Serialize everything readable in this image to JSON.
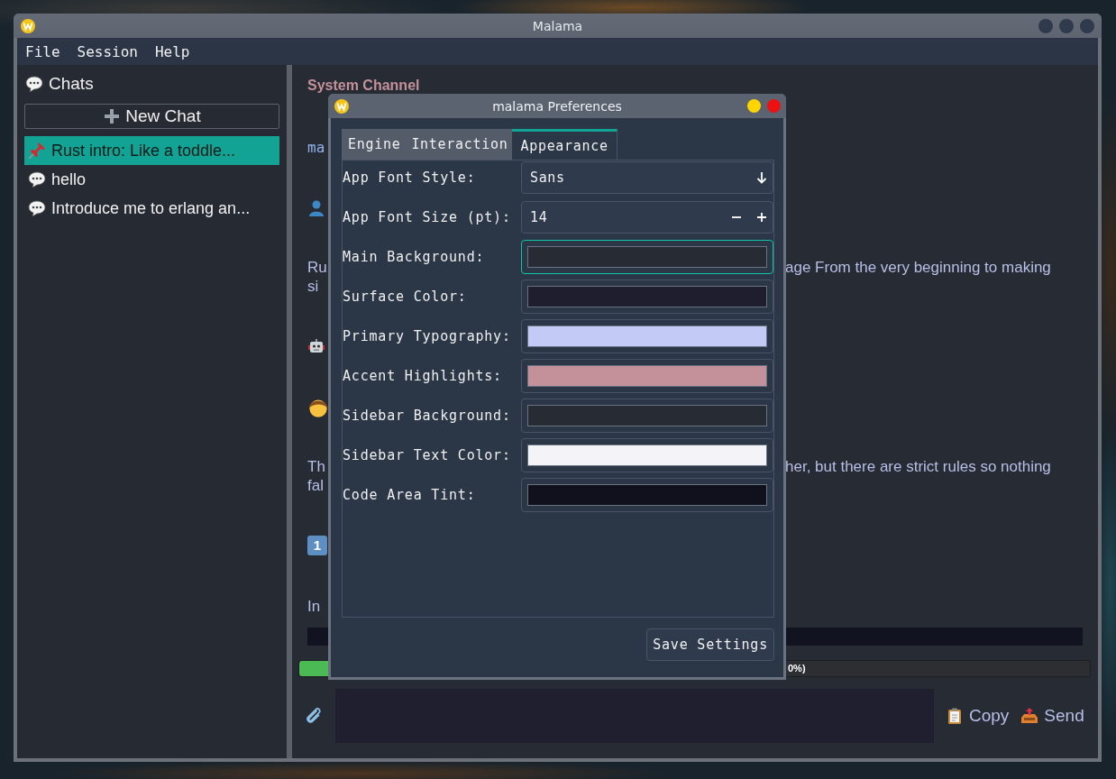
{
  "window": {
    "title": "Malama"
  },
  "menu": [
    "File",
    "Session",
    "Help"
  ],
  "sidebar": {
    "heading": "Chats",
    "new_chat": "New Chat",
    "items": [
      {
        "label": "Rust intro: Like a toddle...",
        "pinned": true,
        "selected": true
      },
      {
        "label": "hello",
        "pinned": false,
        "selected": false
      },
      {
        "label": "Introduce me to erlang an...",
        "pinned": false,
        "selected": false
      }
    ]
  },
  "chat": {
    "blocks": [
      {
        "kind": "heading",
        "text": "System Channel"
      },
      {
        "kind": "code",
        "text": "ma"
      },
      {
        "kind": "user"
      },
      {
        "kind": "paragraph",
        "lines": [
          {
            "left": "Ru",
            "right": "age From the very beginning to making"
          },
          {
            "left": "si"
          }
        ]
      },
      {
        "kind": "bot"
      },
      {
        "kind": "child"
      },
      {
        "kind": "paragraph",
        "lines": [
          {
            "left": "Th",
            "right": "her, but there are strict rules so nothing"
          },
          {
            "left": "fal"
          }
        ]
      },
      {
        "kind": "keycap",
        "text": "1"
      },
      {
        "kind": "paragraph",
        "lines": [
          {
            "left": "In"
          }
        ]
      },
      {
        "kind": "codebar"
      }
    ]
  },
  "progress": {
    "level": 0.04,
    "label": "0%)"
  },
  "composer": {
    "buttons": [
      {
        "kind": "copy",
        "label": "Copy"
      },
      {
        "kind": "send",
        "label": "Send"
      }
    ]
  },
  "dialog": {
    "title": "malama Preferences",
    "tabs": [
      {
        "label": "Engine",
        "selected": false
      },
      {
        "label": "Interaction",
        "selected": false
      },
      {
        "label": "Appearance",
        "selected": true
      }
    ],
    "fields": [
      {
        "kind": "dropdown",
        "label": "App Font Style:",
        "value": "Sans"
      },
      {
        "kind": "spin",
        "label": "App Font Size (pt):",
        "value": "14"
      },
      {
        "kind": "color",
        "label": "Main Background:",
        "color": "#272b34",
        "focused": true
      },
      {
        "kind": "color",
        "label": "Surface Color:",
        "color": "#1f1e2e",
        "focused": false
      },
      {
        "kind": "color",
        "label": "Primary Typography:",
        "color": "#c3caf5",
        "focused": false
      },
      {
        "kind": "color",
        "label": "Accent Highlights:",
        "color": "#c4919a",
        "focused": false
      },
      {
        "kind": "color",
        "label": "Sidebar Background:",
        "color": "#272b34",
        "focused": false
      },
      {
        "kind": "color",
        "label": "Sidebar Text Color:",
        "color": "#f4f4f8",
        "focused": false
      },
      {
        "kind": "color",
        "label": "Code Area Tint:",
        "color": "#10111c",
        "focused": false
      }
    ],
    "save": "Save Settings"
  }
}
